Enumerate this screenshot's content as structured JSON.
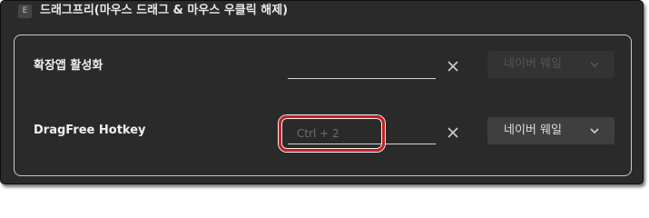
{
  "app": {
    "icon_glyph": "E",
    "icon_name": "extension-icon",
    "title": "드래그프리(마우스 드래그 & 마우스 우클릭 해제)"
  },
  "rows": [
    {
      "label": "확장앱 활성화",
      "hotkey_value": "",
      "hotkey_placeholder": "",
      "clear_icon": "close-icon",
      "dropdown_value": "네이버 웨일",
      "dropdown_enabled": false
    },
    {
      "label": "DragFree Hotkey",
      "hotkey_value": "",
      "hotkey_placeholder": "Ctrl + 2",
      "clear_icon": "close-icon",
      "dropdown_value": "네이버 웨일",
      "dropdown_enabled": true,
      "highlighted": true
    }
  ],
  "colors": {
    "background": "#2a2a2a",
    "panel_border": "#c9c9c9",
    "highlight": "#c41f24",
    "text": "#f0f0f0",
    "disabled_text": "#555555"
  }
}
